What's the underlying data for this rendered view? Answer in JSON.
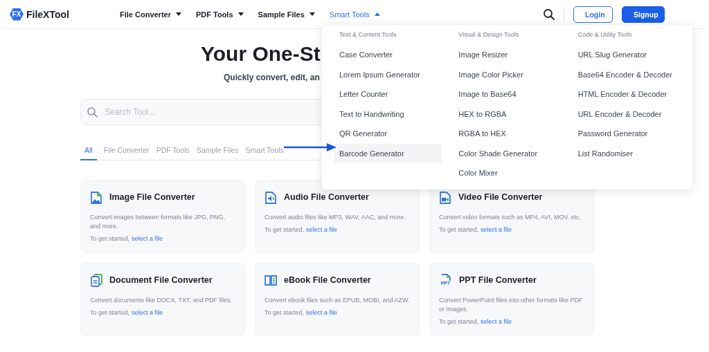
{
  "logo": {
    "badge": "FX",
    "name": "FileXTool"
  },
  "nav": [
    {
      "label": "File Converter",
      "expanded": false
    },
    {
      "label": "PDF Tools",
      "expanded": false
    },
    {
      "label": "Sample Files",
      "expanded": false
    },
    {
      "label": "Smart Tools",
      "expanded": true
    }
  ],
  "auth": {
    "login": "Login",
    "signup": "Signup"
  },
  "hero": {
    "title": "Your One-St",
    "subtitle": "Quickly convert, edit, an"
  },
  "search": {
    "placeholder": "Search Tool..."
  },
  "tabs": [
    {
      "label": "All",
      "selected": true
    },
    {
      "label": "File Converter",
      "selected": false
    },
    {
      "label": "PDF Tools",
      "selected": false
    },
    {
      "label": "Sample Files",
      "selected": false
    },
    {
      "label": "Smart Tools",
      "selected": false
    }
  ],
  "cards": [
    {
      "kind": "image",
      "title": "Image File Converter",
      "description": "Convert images between formats like JPG, PNG, and more.",
      "prompt": "To get started,",
      "link": "select a file"
    },
    {
      "kind": "audio",
      "title": "Audio File Converter",
      "description": "Convert audio files like MP3, WAV, AAC, and more.",
      "prompt": "To get started,",
      "link": "select a file"
    },
    {
      "kind": "video",
      "title": "Video File Converter",
      "description": "Convert video formats such as MP4, AVI, MOV, etc.",
      "prompt": "To get started,",
      "link": "select a file"
    },
    {
      "kind": "document",
      "title": "Document File Converter",
      "description": "Convert documents like DOCX, TXT, and PDF files.",
      "prompt": "To get started,",
      "link": "select a file"
    },
    {
      "kind": "ebook",
      "title": "eBook File Converter",
      "description": "Convert ebook files such as EPUB, MOBI, and AZW.",
      "prompt": "To get started,",
      "link": "select a file"
    },
    {
      "kind": "ppt",
      "icon_text": "PPT",
      "title": "PPT File Converter",
      "description": "Convert PowerPoint files into other formats like PDF or images.",
      "prompt": "To get started,",
      "link": "select a file"
    }
  ],
  "dropdown": {
    "columns": [
      {
        "heading": "Text & Content Tools",
        "items": [
          {
            "label": "Case Converter",
            "selected": false
          },
          {
            "label": "Lorem Ipsum Generator",
            "selected": false
          },
          {
            "label": "Letter Counter",
            "selected": false
          },
          {
            "label": "Text to Handwriting",
            "selected": false
          },
          {
            "label": "QR Generator",
            "selected": false
          },
          {
            "label": "Barcode Generator",
            "selected": true
          }
        ]
      },
      {
        "heading": "Visual & Design Tools",
        "items": [
          {
            "label": "Image Resizer",
            "selected": false
          },
          {
            "label": "Image Color Picker",
            "selected": false
          },
          {
            "label": "Image to Base64",
            "selected": false
          },
          {
            "label": "HEX to RGBA",
            "selected": false
          },
          {
            "label": "RGBA to HEX",
            "selected": false
          },
          {
            "label": "Color Shade Generator",
            "selected": false
          },
          {
            "label": "Color Mixer",
            "selected": false
          }
        ]
      },
      {
        "heading": "Code & Utility Tools",
        "items": [
          {
            "label": "URL Slug Generator",
            "selected": false
          },
          {
            "label": "Base64 Encoder & Decoder",
            "selected": false
          },
          {
            "label": "HTML Encoder & Decoder",
            "selected": false
          },
          {
            "label": "URL Encoder & Decoder",
            "selected": false
          },
          {
            "label": "Password Generator",
            "selected": false
          },
          {
            "label": "List Randomiser",
            "selected": false
          }
        ]
      }
    ]
  }
}
